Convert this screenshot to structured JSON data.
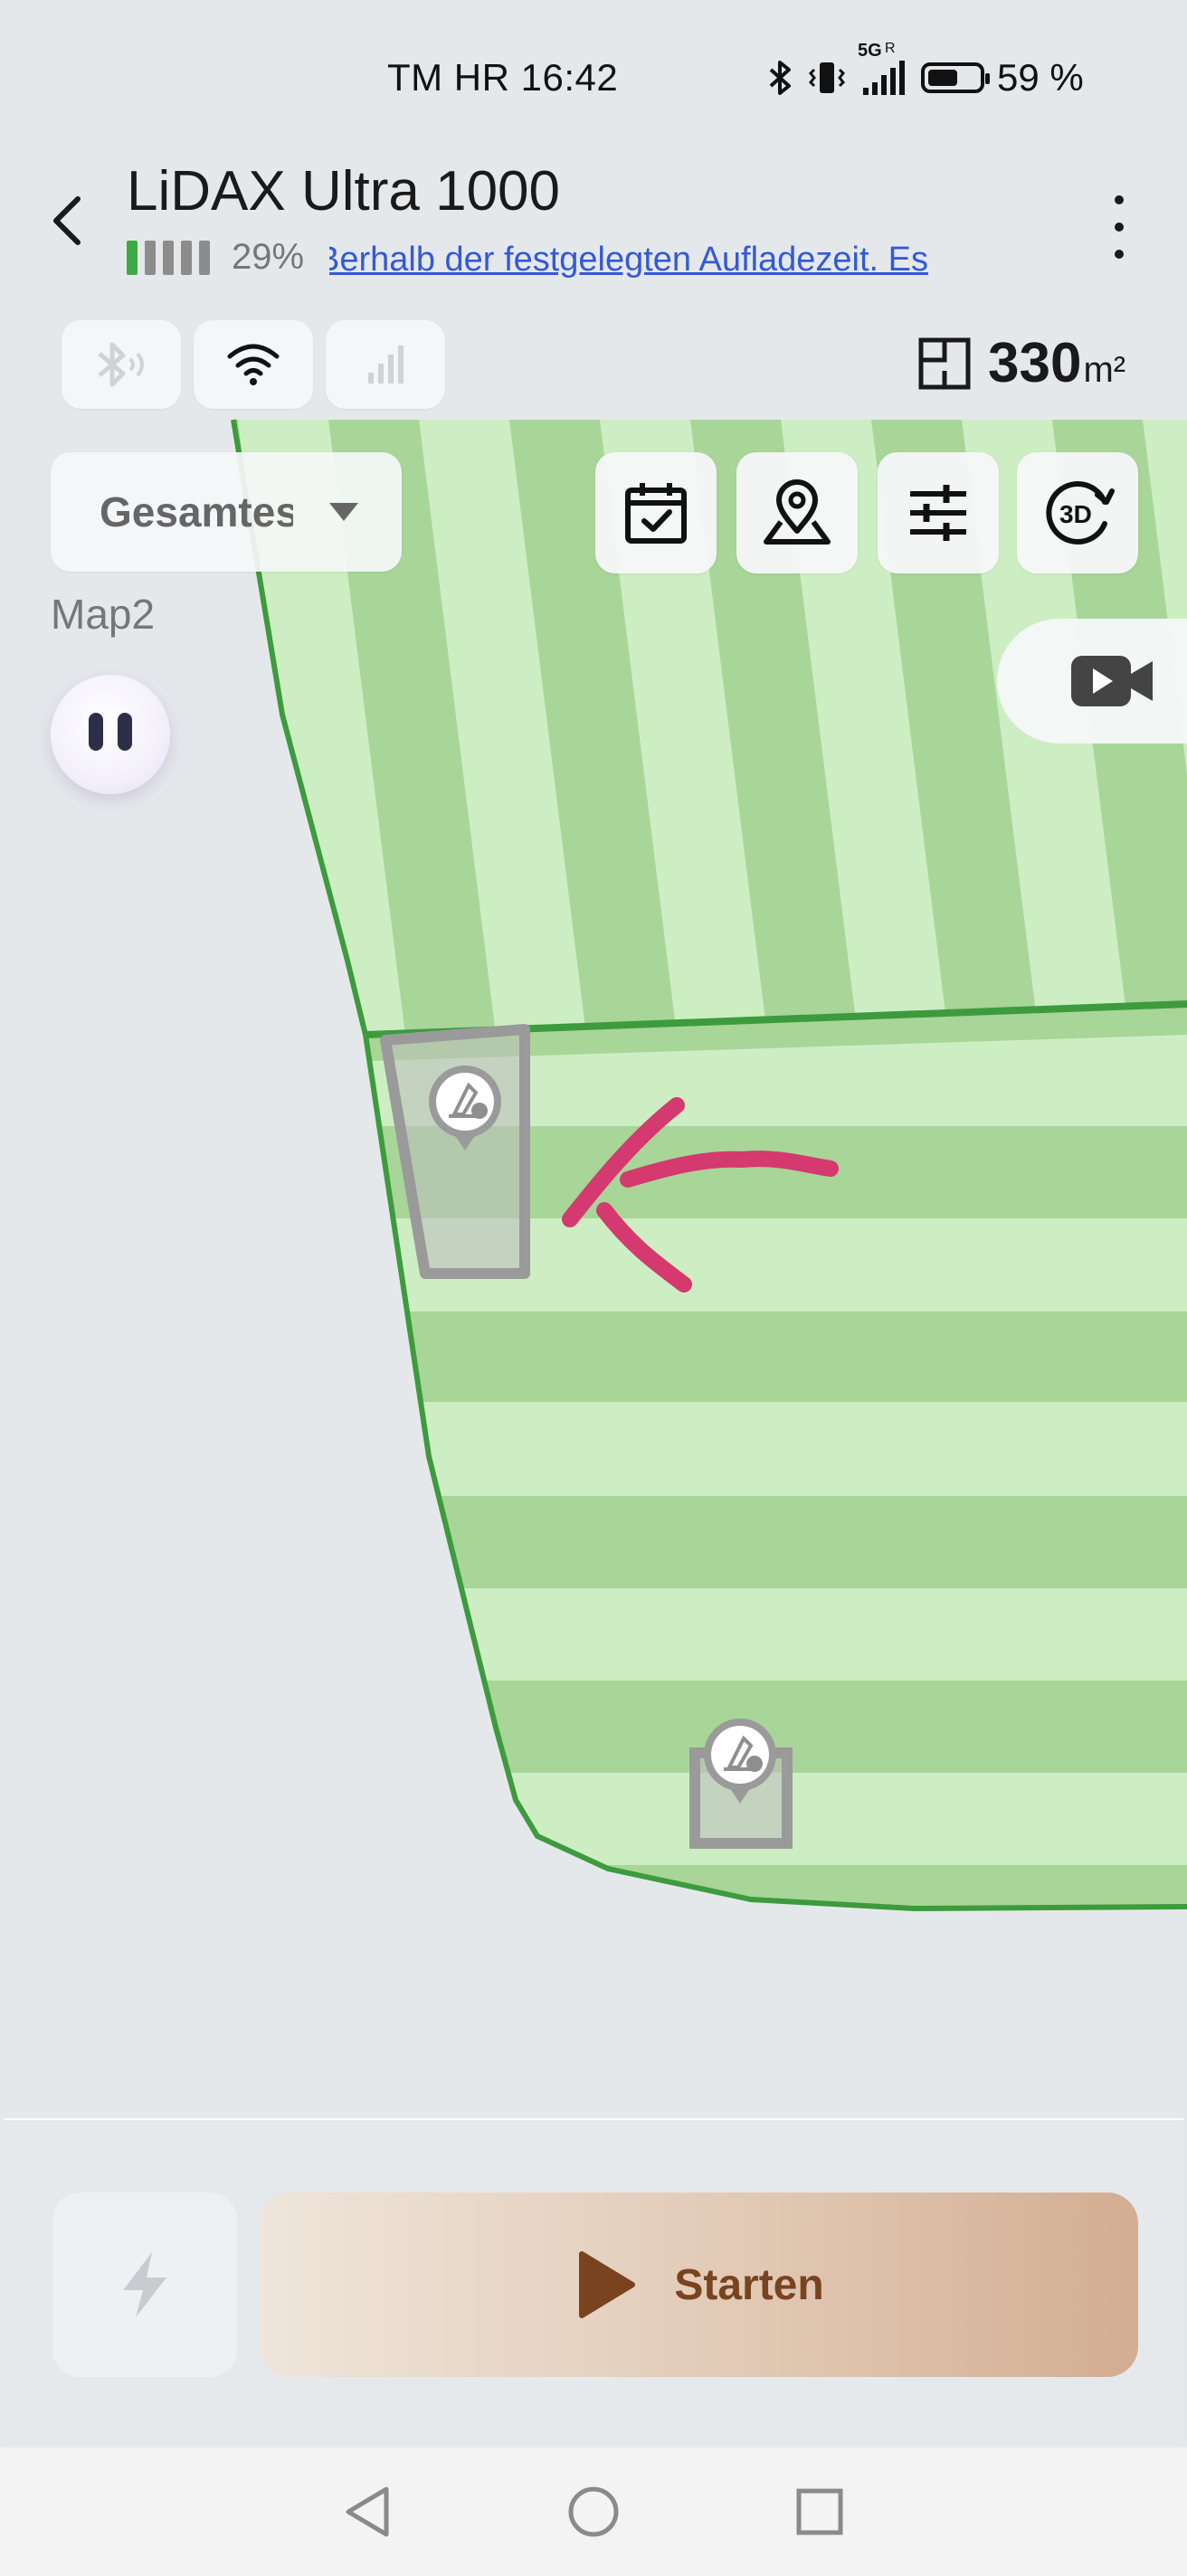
{
  "status_bar": {
    "carrier": "TM HR",
    "time": "16:42",
    "network": "5G",
    "network_sub": "R",
    "battery_level": 0.59,
    "battery_text": "59 %"
  },
  "header": {
    "title": "LiDAX Ultra 1000",
    "battery_percent": "29%",
    "battery_segments_filled": 1,
    "battery_segments_total": 5,
    "marquee": "Berhalb der festgelegten Aufladezeit. Es"
  },
  "connectivity": {
    "bluetooth_state": "inactive",
    "wifi_state": "active",
    "cellular_state": "inactive"
  },
  "area": {
    "value": "330",
    "unit": "m²"
  },
  "zone_selector": {
    "label": "Gesamtes"
  },
  "map": {
    "name": "Map2",
    "lawn_color": "#cdeec3",
    "stripe_color": "#a8d598",
    "boundary_color": "#3d9b3d",
    "obstacle_color": "#9a9a9a",
    "annotation_color": "#d4396f"
  },
  "toolbar": {
    "icons": [
      "calendar-check-icon",
      "map-pin-icon",
      "sliders-icon",
      "3d-view-icon"
    ],
    "video_icon": "video-play-icon"
  },
  "actions": {
    "start_label": "Starten"
  },
  "accent": {
    "start_text": "#7a4320",
    "start_icon": "#7a4320"
  }
}
